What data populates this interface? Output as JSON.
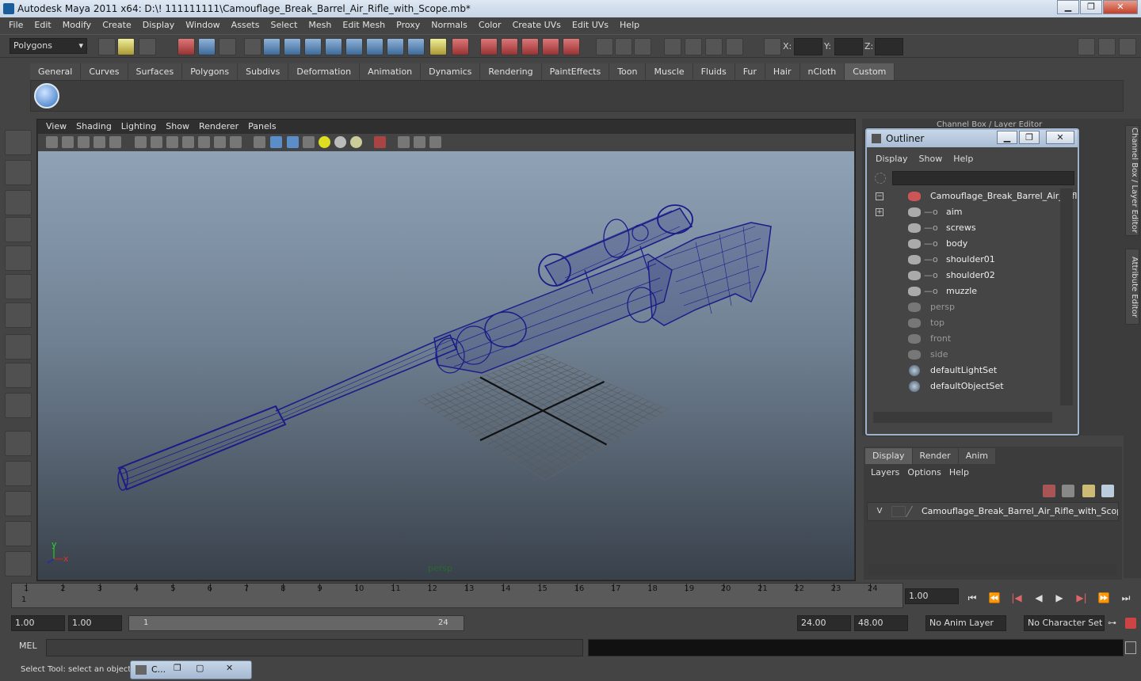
{
  "window": {
    "title": "Autodesk Maya 2011 x64: D:\\! 111111111\\Camouflage_Break_Barrel_Air_Rifle_with_Scope.mb*",
    "minimize": "▁",
    "maximize": "❐",
    "close": "✕"
  },
  "menubar": [
    "File",
    "Edit",
    "Modify",
    "Create",
    "Display",
    "Window",
    "Assets",
    "Select",
    "Mesh",
    "Edit Mesh",
    "Proxy",
    "Normals",
    "Color",
    "Create UVs",
    "Edit UVs",
    "Help"
  ],
  "toolbar": {
    "mode": "Polygons",
    "x_label": "X:",
    "y_label": "Y:",
    "z_label": "Z:"
  },
  "shelf": {
    "tabs": [
      "General",
      "Curves",
      "Surfaces",
      "Polygons",
      "Subdivs",
      "Deformation",
      "Animation",
      "Dynamics",
      "Rendering",
      "PaintEffects",
      "Toon",
      "Muscle",
      "Fluids",
      "Fur",
      "Hair",
      "nCloth",
      "Custom"
    ],
    "active": "Custom"
  },
  "viewport": {
    "menu": [
      "View",
      "Shading",
      "Lighting",
      "Show",
      "Renderer",
      "Panels"
    ],
    "camera": "persp",
    "axis_x": "x",
    "axis_y": "y"
  },
  "channel_box": {
    "title": "Channel Box / Layer Editor"
  },
  "outliner": {
    "title": "Outliner",
    "menu": [
      "Display",
      "Show",
      "Help"
    ],
    "items": [
      {
        "label": "Camouflage_Break_Barrel_Air_Rifl",
        "expand": "−"
      },
      {
        "label": "aim",
        "expand": "+"
      },
      {
        "label": "screws"
      },
      {
        "label": "body"
      },
      {
        "label": "shoulder01"
      },
      {
        "label": "shoulder02"
      },
      {
        "label": "muzzle"
      },
      {
        "label": "persp"
      },
      {
        "label": "top"
      },
      {
        "label": "front"
      },
      {
        "label": "side"
      },
      {
        "label": "defaultLightSet"
      },
      {
        "label": "defaultObjectSet"
      }
    ]
  },
  "side_tabs": [
    "Channel Box / Layer Editor",
    "Attribute Editor"
  ],
  "layers": {
    "tabs": [
      "Display",
      "Render",
      "Anim"
    ],
    "active": "Display",
    "menu": [
      "Layers",
      "Options",
      "Help"
    ],
    "row": {
      "visible": "V",
      "name": "Camouflage_Break_Barrel_Air_Rifle_with_Scope_la"
    }
  },
  "timeline": {
    "ticks": [
      "1",
      "2",
      "3",
      "4",
      "5",
      "6",
      "7",
      "8",
      "9",
      "10",
      "11",
      "12",
      "13",
      "14",
      "15",
      "16",
      "17",
      "18",
      "19",
      "20",
      "21",
      "22",
      "23",
      "24"
    ],
    "current_marker": "1",
    "current_frame": "1.00"
  },
  "range": {
    "start": "1.00",
    "playback_start": "1.00",
    "slider_start": "1",
    "slider_end": "24",
    "playback_end": "24.00",
    "end": "48.00",
    "anim_layer": "No Anim Layer",
    "character_set": "No Character Set"
  },
  "mel": {
    "label": "MEL"
  },
  "status": {
    "help": "Select Tool: select an object",
    "minimized_window": "C..."
  }
}
